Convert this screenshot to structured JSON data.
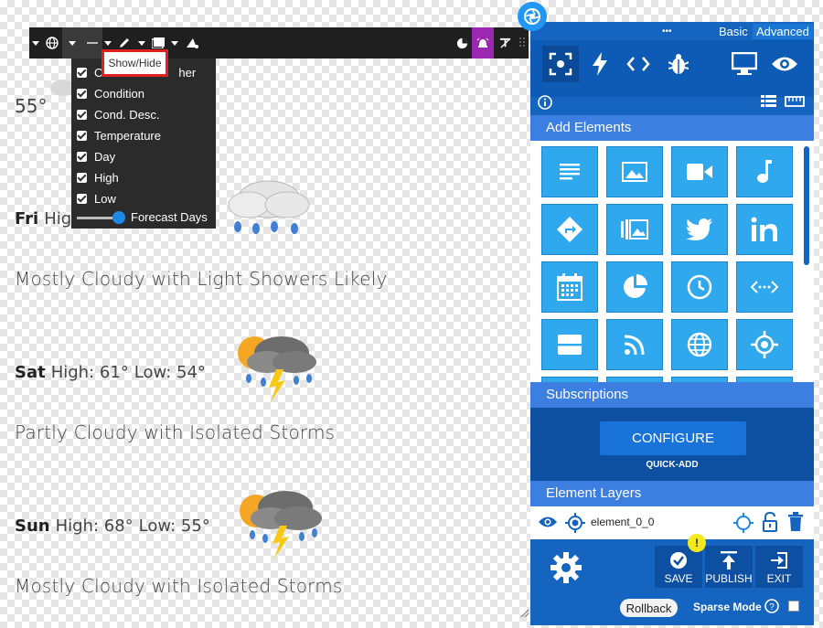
{
  "forecast": {
    "current_temp": "55°",
    "days": [
      {
        "day": "Fri",
        "high_prefix": "Hig",
        "high": "",
        "low": "",
        "desc": "Mostly Cloudy with Light Showers Likely"
      },
      {
        "day": "Sat",
        "high": "High: 61°",
        "low": "Low: 54°",
        "desc": "Partly Cloudy with Isolated Storms"
      },
      {
        "day": "Sun",
        "high": "High: 68°",
        "low": "Low: 55°",
        "desc": "Mostly Cloudy with Isolated Storms"
      }
    ]
  },
  "toolbar": {
    "tooltip": "Show/Hide"
  },
  "dropdown": {
    "items": [
      "C",
      "Condition",
      "Cond. Desc.",
      "Temperature",
      "Day",
      "High",
      "Low"
    ],
    "partial_tail": "her",
    "slider_label": "Forecast Days",
    "slider_value_fraction": 0.85
  },
  "panel": {
    "tabs": {
      "dots": "•••",
      "basic": "Basic",
      "advanced": "Advanced"
    },
    "add_elements": "Add Elements",
    "subscriptions": "Subscriptions",
    "configure": "CONFIGURE",
    "quick_add": "QUICK-ADD",
    "element_layers": "Element Layers",
    "layer_name": "element_0_0",
    "save": "SAVE",
    "publish": "PUBLISH",
    "exit": "EXIT",
    "badge": "!",
    "rollback": "Rollback",
    "sparse_mode": "Sparse Mode"
  },
  "colors": {
    "panel_blue": "#1565c0",
    "tile_blue": "#2fa8ee",
    "header_blue": "#3d7fe0",
    "toolbar_dark": "#1f1f1f",
    "purple": "#9c27b0",
    "tooltip_border": "#e02020"
  }
}
